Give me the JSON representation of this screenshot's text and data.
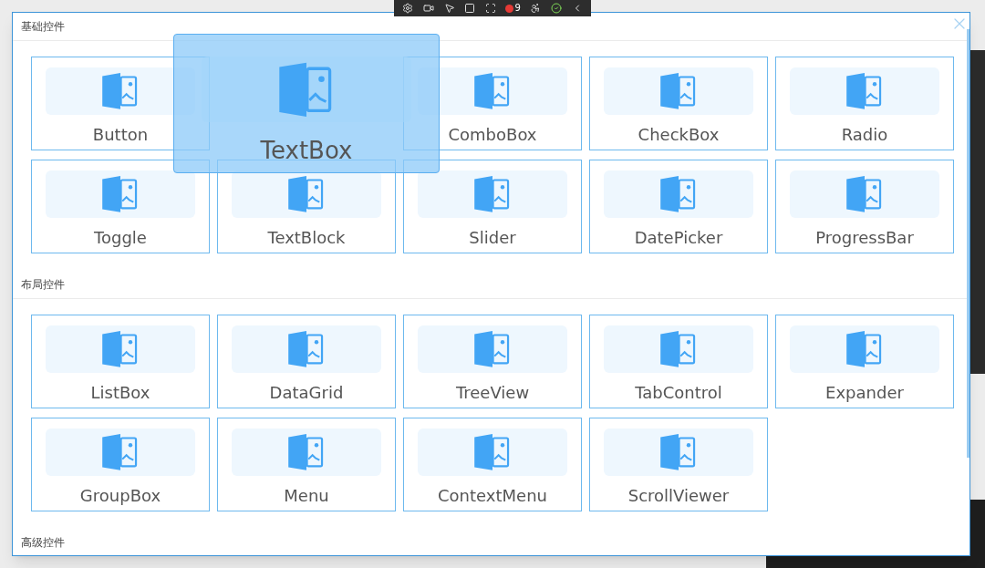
{
  "toolbar": {
    "badge": "9"
  },
  "window": {
    "sections": [
      {
        "title": "基础控件",
        "items": [
          {
            "label": "Button",
            "dragging": false
          },
          {
            "label": "TextBox",
            "dragging": true
          },
          {
            "label": "ComboBox",
            "dragging": false
          },
          {
            "label": "CheckBox",
            "dragging": false
          },
          {
            "label": "Radio",
            "dragging": false
          },
          {
            "label": "Toggle",
            "dragging": false
          },
          {
            "label": "TextBlock",
            "dragging": false
          },
          {
            "label": "Slider",
            "dragging": false
          },
          {
            "label": "DatePicker",
            "dragging": false
          },
          {
            "label": "ProgressBar",
            "dragging": false
          }
        ]
      },
      {
        "title": "布局控件",
        "items": [
          {
            "label": "ListBox",
            "dragging": false
          },
          {
            "label": "DataGrid",
            "dragging": false
          },
          {
            "label": "TreeView",
            "dragging": false
          },
          {
            "label": "TabControl",
            "dragging": false
          },
          {
            "label": "Expander",
            "dragging": false
          },
          {
            "label": "GroupBox",
            "dragging": false
          },
          {
            "label": "Menu",
            "dragging": false
          },
          {
            "label": "ContextMenu",
            "dragging": false
          },
          {
            "label": "ScrollViewer",
            "dragging": false
          }
        ]
      },
      {
        "title": "高级控件"
      }
    ]
  }
}
